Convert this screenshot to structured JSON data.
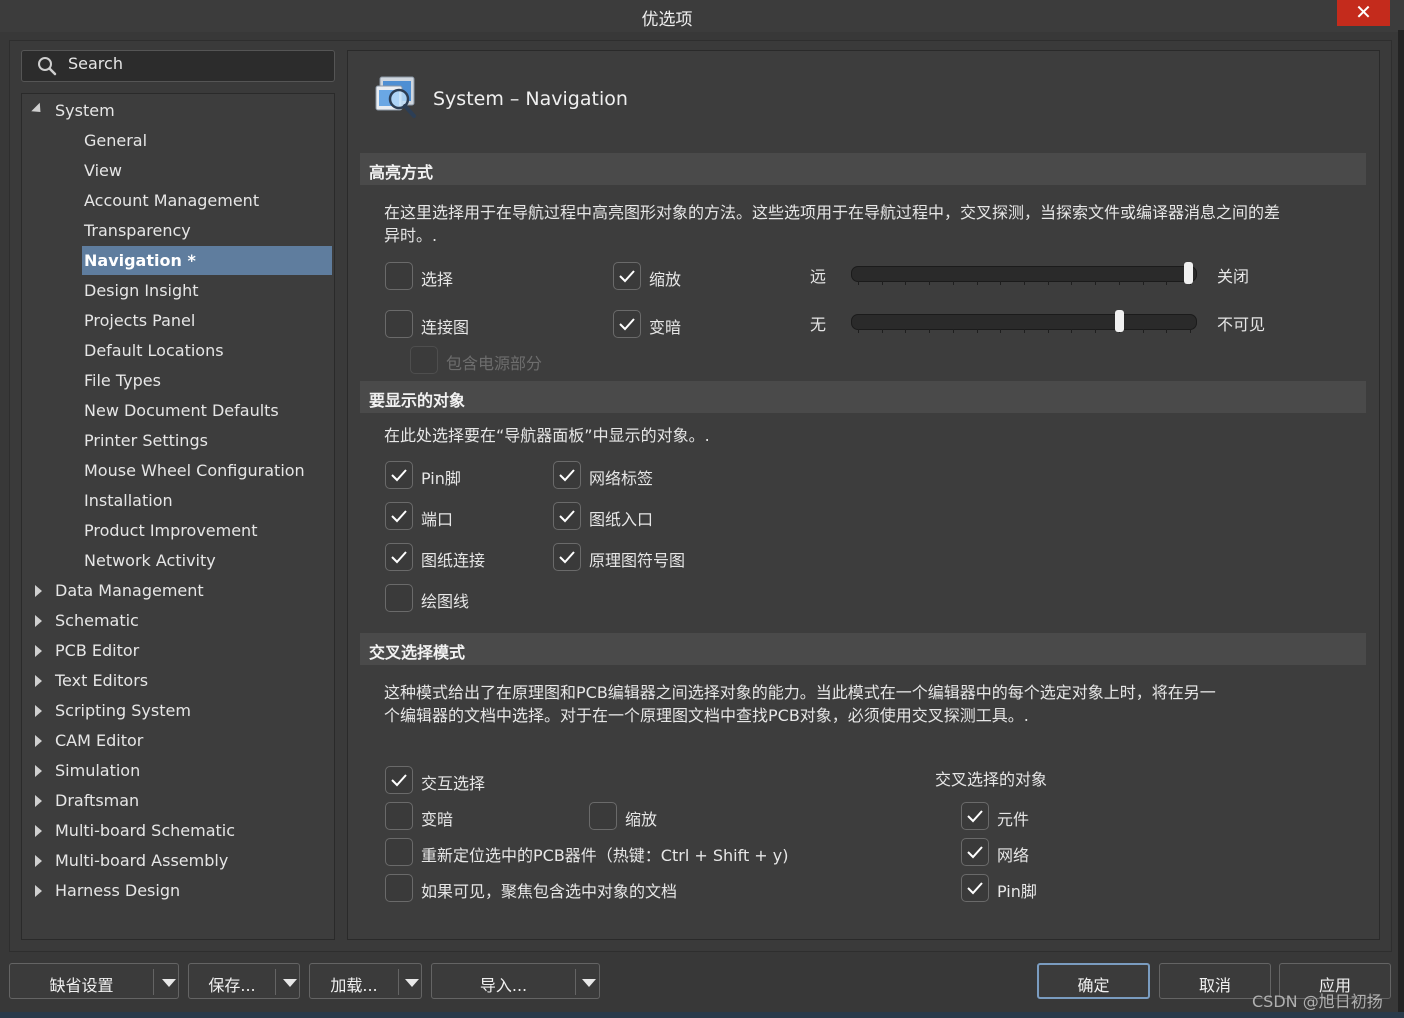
{
  "window": {
    "title": "优选项",
    "close_glyph": "✕"
  },
  "search": {
    "placeholder": "Search"
  },
  "tree": {
    "root": "System",
    "system_children": [
      "General",
      "View",
      "Account Management",
      "Transparency",
      "Navigation *",
      "Design Insight",
      "Projects Panel",
      "Default Locations",
      "File Types",
      "New Document Defaults",
      "Printer Settings",
      "Mouse Wheel Configuration",
      "Installation",
      "Product Improvement",
      "Network Activity"
    ],
    "selected": "Navigation *",
    "other_roots": [
      "Data Management",
      "Schematic",
      "PCB Editor",
      "Text Editors",
      "Scripting System",
      "CAM Editor",
      "Simulation",
      "Draftsman",
      "Multi-board Schematic",
      "Multi-board Assembly",
      "Harness Design"
    ]
  },
  "page": {
    "title": "System – Navigation",
    "icon": "navigation-magnifier-icon"
  },
  "highlight": {
    "header": "高亮方式",
    "desc_line1": "在这里选择用于在导航过程中高亮图形对象的方法。这些选项用于在导航过程中，交叉探测，当探索文件或编译器消息之间的差",
    "desc_line2": "异时。.",
    "select": {
      "label": "选择",
      "checked": false
    },
    "zoom": {
      "label": "缩放",
      "checked": true
    },
    "connection_graph": {
      "label": "连接图",
      "checked": false
    },
    "dim": {
      "label": "变暗",
      "checked": true
    },
    "include_power": {
      "label": "包含电源部分",
      "checked": false,
      "enabled": false
    },
    "zoom_slider": {
      "left_label": "远",
      "right_label": "关闭",
      "value": 1.0
    },
    "dim_slider": {
      "left_label": "无",
      "right_label": "不可见",
      "value": 0.79
    }
  },
  "objects": {
    "header": "要显示的对象",
    "desc": "在此处选择要在“导航器面板”中显示的对象。.",
    "items": [
      {
        "label": "Pin脚",
        "checked": true
      },
      {
        "label": "网络标签",
        "checked": true
      },
      {
        "label": "端口",
        "checked": true
      },
      {
        "label": "图纸入口",
        "checked": true
      },
      {
        "label": "图纸连接",
        "checked": true
      },
      {
        "label": "原理图符号图",
        "checked": true
      },
      {
        "label": "绘图线",
        "checked": false
      }
    ]
  },
  "cross": {
    "header": "交叉选择模式",
    "desc_line1": "这种模式给出了在原理图和PCB编辑器之间选择对象的能力。当此模式在一个编辑器中的每个选定对象上时，将在另一",
    "desc_line2": "个编辑器的文档中选择。对于在一个原理图文档中查找PCB对象，必须使用交叉探测工具。.",
    "cross_select": {
      "label": "交互选择",
      "checked": true
    },
    "dim": {
      "label": "变暗",
      "checked": false
    },
    "zoom": {
      "label": "缩放",
      "checked": false
    },
    "reposition": {
      "label": "重新定位选中的PCB器件（热键：Ctrl + Shift + y)",
      "checked": false
    },
    "focus": {
      "label": "如果可见，聚焦包含选中对象的文档",
      "checked": false
    },
    "objects_title": "交叉选择的对象",
    "components": {
      "label": "元件",
      "checked": true
    },
    "nets": {
      "label": "网络",
      "checked": true
    },
    "pins": {
      "label": "Pin脚",
      "checked": true
    }
  },
  "footer": {
    "defaults": "缺省设置",
    "save": "保存...",
    "load": "加载...",
    "import": "导入...",
    "ok": "确定",
    "cancel": "取消",
    "apply": "应用",
    "watermark": "CSDN @旭日初扬"
  },
  "colors": {
    "accent": "#5f7d9e",
    "close": "#c42b1c",
    "background": "#383838"
  }
}
